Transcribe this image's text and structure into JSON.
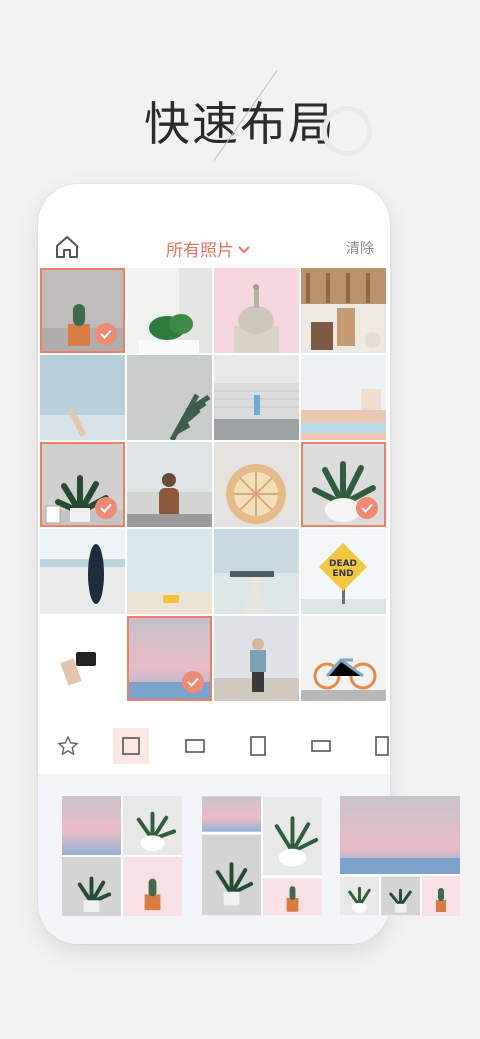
{
  "headline": "快速布局",
  "header": {
    "album_label": "所有照片",
    "clear_label": "清除"
  },
  "colors": {
    "accent": "#e7735e",
    "selection": "#ea8066",
    "check": "#ef8b72"
  },
  "photos": [
    {
      "name": "cactus-pot",
      "selected": true
    },
    {
      "name": "monstera-leaves",
      "selected": false
    },
    {
      "name": "capitol-dome",
      "selected": false
    },
    {
      "name": "desserts-table",
      "selected": false
    },
    {
      "name": "hand-sky",
      "selected": false
    },
    {
      "name": "palm-leaf",
      "selected": false
    },
    {
      "name": "walker-wall",
      "selected": false
    },
    {
      "name": "pastel-pool",
      "selected": false
    },
    {
      "name": "plant-frame",
      "selected": true
    },
    {
      "name": "woman-beach",
      "selected": false
    },
    {
      "name": "pie",
      "selected": false
    },
    {
      "name": "succulent-bowl",
      "selected": true
    },
    {
      "name": "surfboard",
      "selected": false
    },
    {
      "name": "beach-car",
      "selected": false
    },
    {
      "name": "pier",
      "selected": false
    },
    {
      "name": "dead-end-sign",
      "selected": false
    },
    {
      "name": "hand-camera",
      "selected": false
    },
    {
      "name": "pastel-horizon",
      "selected": true
    },
    {
      "name": "boy-rocks",
      "selected": false
    },
    {
      "name": "bicycle",
      "selected": false
    }
  ],
  "dead_end_sign": "DEAD END",
  "toolbar": {
    "icons": [
      "star-icon",
      "square-layout-icon",
      "landscape-layout-icon",
      "portrait-layout-icon",
      "wide-layout-icon",
      "tall-layout-icon"
    ],
    "active_index": 1
  }
}
